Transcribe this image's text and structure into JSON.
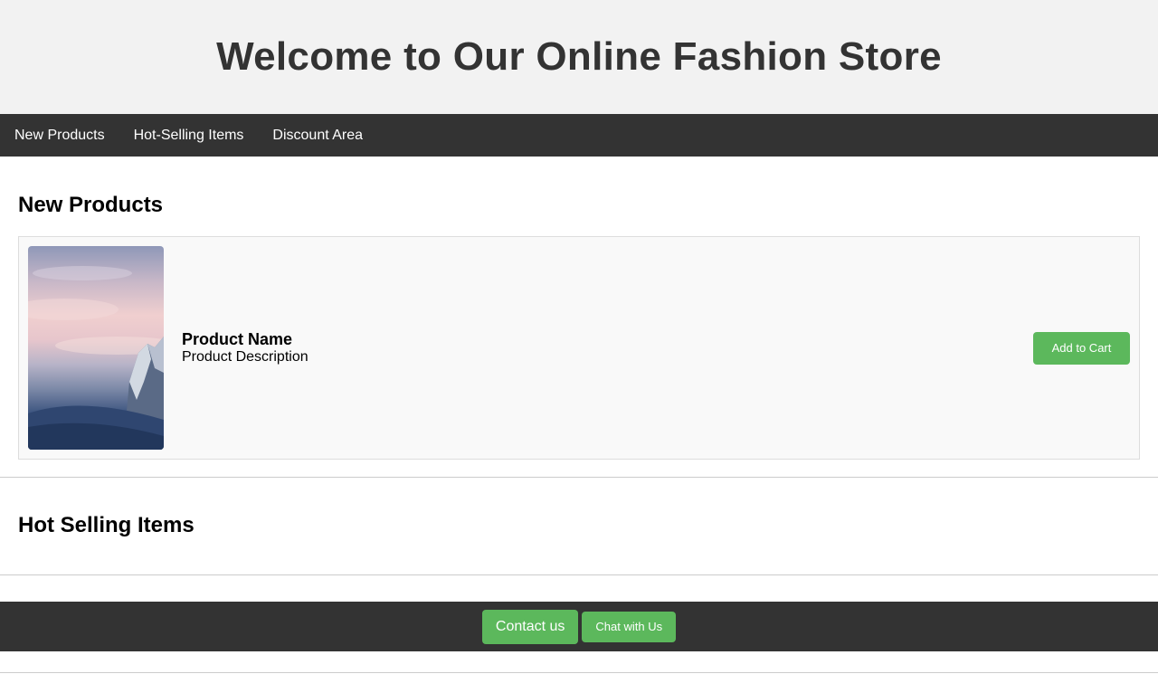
{
  "header": {
    "title": "Welcome to Our Online Fashion Store"
  },
  "nav": {
    "items": [
      {
        "label": "New Products"
      },
      {
        "label": "Hot-Selling Items"
      },
      {
        "label": "Discount Area"
      }
    ]
  },
  "new_products": {
    "heading": "New Products",
    "product": {
      "name": "Product Name",
      "description": "Product Description",
      "add_to_cart_label": "Add to Cart"
    }
  },
  "hot_selling": {
    "heading": "Hot Selling Items"
  },
  "footer": {
    "contact_label": "Contact us",
    "chat_label": "Chat with Us"
  },
  "colors": {
    "header_bg": "#f2f2f2",
    "nav_bg": "#333333",
    "button_green": "#5cb85c",
    "card_bg": "#f9f9f9"
  }
}
